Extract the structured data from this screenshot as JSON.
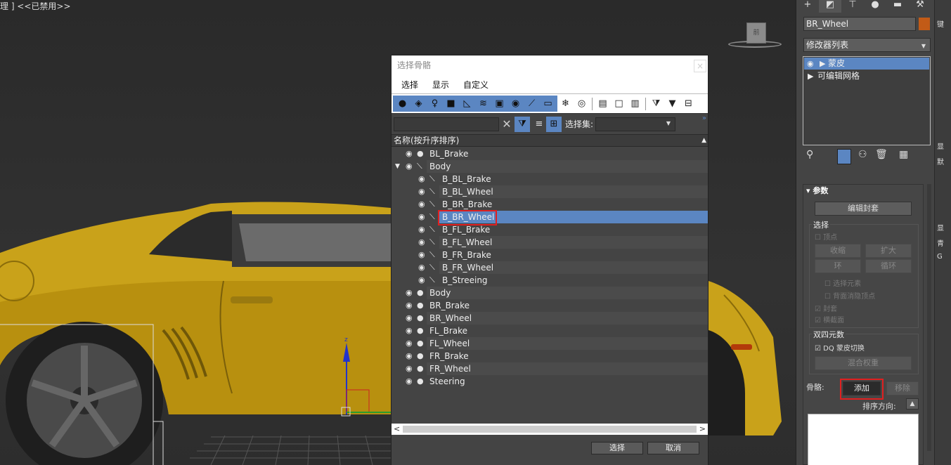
{
  "viewport": {
    "label": "理 ] <<已禁用>>",
    "viewcube_text": "前"
  },
  "dialog": {
    "title": "选择骨骼",
    "close_label": "×",
    "menu": [
      "选择",
      "显示",
      "自定义"
    ],
    "search_clear": "✕",
    "selection_set_label": "选择集:",
    "column_header": "名称(按升序排序)",
    "sort_arrow": "▲",
    "tree": [
      {
        "label": "BL_Brake",
        "depth": 0,
        "kind": "dot"
      },
      {
        "label": "Body",
        "depth": 0,
        "kind": "bone",
        "expanded": true
      },
      {
        "label": "B_BL_Brake",
        "depth": 1,
        "kind": "bone"
      },
      {
        "label": "B_BL_Wheel",
        "depth": 1,
        "kind": "bone"
      },
      {
        "label": "B_BR_Brake",
        "depth": 1,
        "kind": "bone"
      },
      {
        "label": "B_BR_Wheel",
        "depth": 1,
        "kind": "bone",
        "selected": true
      },
      {
        "label": "B_FL_Brake",
        "depth": 1,
        "kind": "bone"
      },
      {
        "label": "B_FL_Wheel",
        "depth": 1,
        "kind": "bone"
      },
      {
        "label": "B_FR_Brake",
        "depth": 1,
        "kind": "bone"
      },
      {
        "label": "B_FR_Wheel",
        "depth": 1,
        "kind": "bone"
      },
      {
        "label": "B_Streeing",
        "depth": 1,
        "kind": "bone"
      },
      {
        "label": "Body",
        "depth": 0,
        "kind": "dot"
      },
      {
        "label": "BR_Brake",
        "depth": 0,
        "kind": "dot"
      },
      {
        "label": "BR_Wheel",
        "depth": 0,
        "kind": "dot"
      },
      {
        "label": "FL_Brake",
        "depth": 0,
        "kind": "dot"
      },
      {
        "label": "FL_Wheel",
        "depth": 0,
        "kind": "dot"
      },
      {
        "label": "FR_Brake",
        "depth": 0,
        "kind": "dot"
      },
      {
        "label": "FR_Wheel",
        "depth": 0,
        "kind": "dot"
      },
      {
        "label": "Steering",
        "depth": 0,
        "kind": "dot"
      }
    ],
    "select_button": "选择",
    "cancel_button": "取消"
  },
  "command_panel": {
    "object_name": "BR_Wheel",
    "object_color": "#c25b17",
    "modifier_list": "修改器列表",
    "stack": [
      {
        "label": "蒙皮",
        "selected": true
      },
      {
        "label": "可编辑网格",
        "selected": false
      }
    ],
    "rollout_title": "参数",
    "edit_envelope": "编辑封套",
    "selection_group": "选择",
    "vertex": "顶点",
    "shrink": "收缩",
    "grow": "扩大",
    "ring": "环",
    "loop": "循环",
    "select_element": "选择元素",
    "backface_cull": "背面消隐顶点",
    "envelope": "封套",
    "cross_section": "横截面",
    "dq_group": "双四元数",
    "dq_toggle": "DQ 蒙皮切换",
    "blend_weights": "混合权重",
    "bones_label": "骨骼:",
    "add_button": "添加",
    "remove_button": "移除",
    "sort_direction": "排序方向:",
    "strip_letters": [
      "键",
      "显",
      "默",
      "显",
      "青",
      "G"
    ]
  }
}
